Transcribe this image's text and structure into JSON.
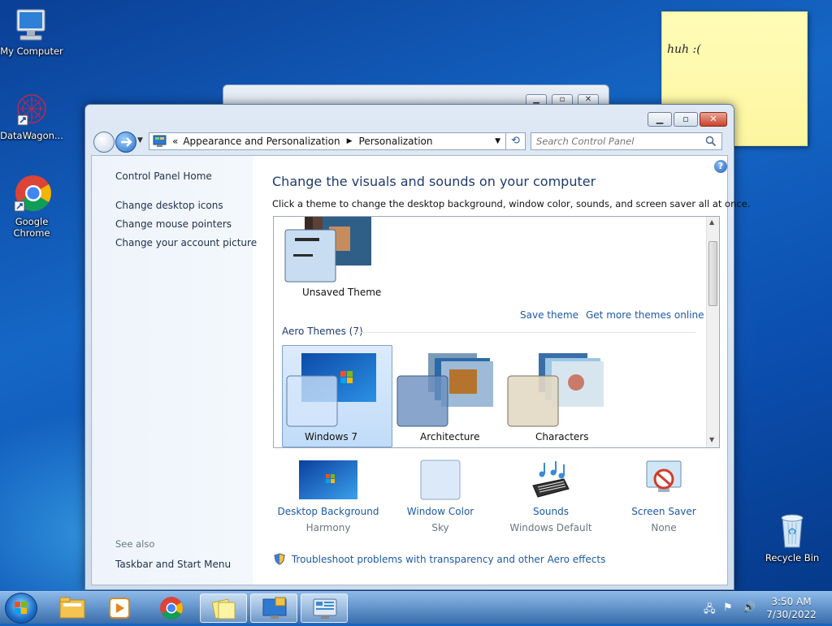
{
  "desktop": {
    "icons": [
      {
        "label": "My Computer"
      },
      {
        "label": "DataWagon..."
      },
      {
        "label": "Google Chrome"
      },
      {
        "label": "Recycle Bin"
      }
    ],
    "sticky_note": "huh :("
  },
  "window": {
    "address_sep": "«",
    "breadcrumb": [
      "Appearance and Personalization",
      "Personalization"
    ],
    "search_placeholder": "Search Control Panel",
    "left_links": [
      "Control Panel Home",
      "Change desktop icons",
      "Change mouse pointers",
      "Change your account picture"
    ],
    "see_also_label": "See also",
    "see_also_links": [
      "Taskbar and Start Menu"
    ],
    "title": "Change the visuals and sounds on your computer",
    "subtitle": "Click a theme to change the desktop background, window color, sounds, and screen saver all at once.",
    "my_themes": {
      "unsaved_theme": "Unsaved Theme",
      "save_theme": "Save theme",
      "get_more": "Get more themes online"
    },
    "aero_header": "Aero Themes (7)",
    "aero_themes": [
      "Windows 7",
      "Architecture",
      "Characters"
    ],
    "selected_theme": "Windows 7",
    "settings": [
      {
        "title": "Desktop Background",
        "value": "Harmony"
      },
      {
        "title": "Window Color",
        "value": "Sky"
      },
      {
        "title": "Sounds",
        "value": "Windows Default"
      },
      {
        "title": "Screen Saver",
        "value": "None"
      }
    ],
    "troubleshoot": "Troubleshoot problems with transparency and other Aero effects"
  },
  "taskbar": {
    "time": "3:50 AM",
    "date": "7/30/2022"
  },
  "colors": {
    "link": "#1c5aa6",
    "title": "#1e3a6e",
    "desktop": "#1565c0"
  }
}
